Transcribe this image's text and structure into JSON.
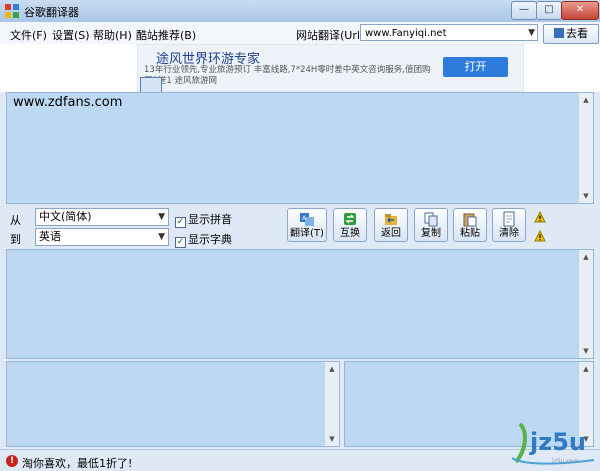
{
  "window": {
    "title": "谷歌翻译器",
    "min": "—",
    "max": "□",
    "close": "✕"
  },
  "menu": [
    "文件(F)",
    "设置(S)",
    "帮助(H)",
    "酷站推荐(B)"
  ],
  "url_bar": {
    "label": "网站翻译(Url)",
    "value": "www.Fanyiqi.net",
    "go_label": "去看"
  },
  "ad": {
    "title": "途风世界环游专家",
    "desc": "13年行业领先,专业旅游预订 丰富线路,7*24H零时差中英文咨询服务,值团购买2送1 途风旅游网",
    "button": "打开"
  },
  "source": {
    "text": "www.zdfans.com"
  },
  "lang": {
    "from_label": "从",
    "to_label": "到",
    "from_value": "中文(简体)",
    "to_value": "英语"
  },
  "options": {
    "pinyin": "显示拼音",
    "dict": "显示字典"
  },
  "toolbar": [
    {
      "label": "翻译(T)",
      "icon": "translate-icon"
    },
    {
      "label": "互换",
      "icon": "swap-icon"
    },
    {
      "label": "返回",
      "icon": "back-icon"
    },
    {
      "label": "复制",
      "icon": "copy-icon"
    },
    {
      "label": "粘贴",
      "icon": "paste-icon"
    },
    {
      "label": "清除",
      "icon": "clear-icon"
    }
  ],
  "status": {
    "text": "淘你喜欢，最低1折了!"
  },
  "watermark": {
    "logo": "jz5u",
    "url": "jz5u.com"
  },
  "colors": {
    "panel": "#bdd8f2",
    "accent": "#2e7bdc"
  }
}
